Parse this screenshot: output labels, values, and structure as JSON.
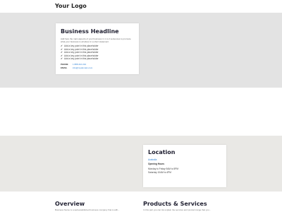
{
  "header": {
    "logo": "Your Logo"
  },
  "business_card": {
    "headline": "Business Headline",
    "description": "Add here the main aspects of your business in 1 to 2 sentences to promote what your business is all about in a short statement.",
    "bullets": [
      "Add a key point in this placeholder",
      "Add a key point in this placeholder",
      "Add a key point in this placeholder",
      "Add a key point in this placeholder",
      "Add a key point in this placeholder"
    ],
    "phone_label": "PHONE",
    "phone": "1 888 210 210",
    "email_label": "EMAIL",
    "email": "info@mydomain.com"
  },
  "location": {
    "title": "Location",
    "link": "Australia",
    "hours_label": "Opening Hours",
    "hours": [
      "Monday to Friday 9AM to 5PM",
      "Saturday 10AM to 4PM"
    ]
  },
  "sections": {
    "overview_title": "Overview",
    "overview_text": "Business Name is a well-established business company that is willi...",
    "products_title": "Products & Services",
    "products_text": "In this part you can list explain the services and product range that you..."
  }
}
